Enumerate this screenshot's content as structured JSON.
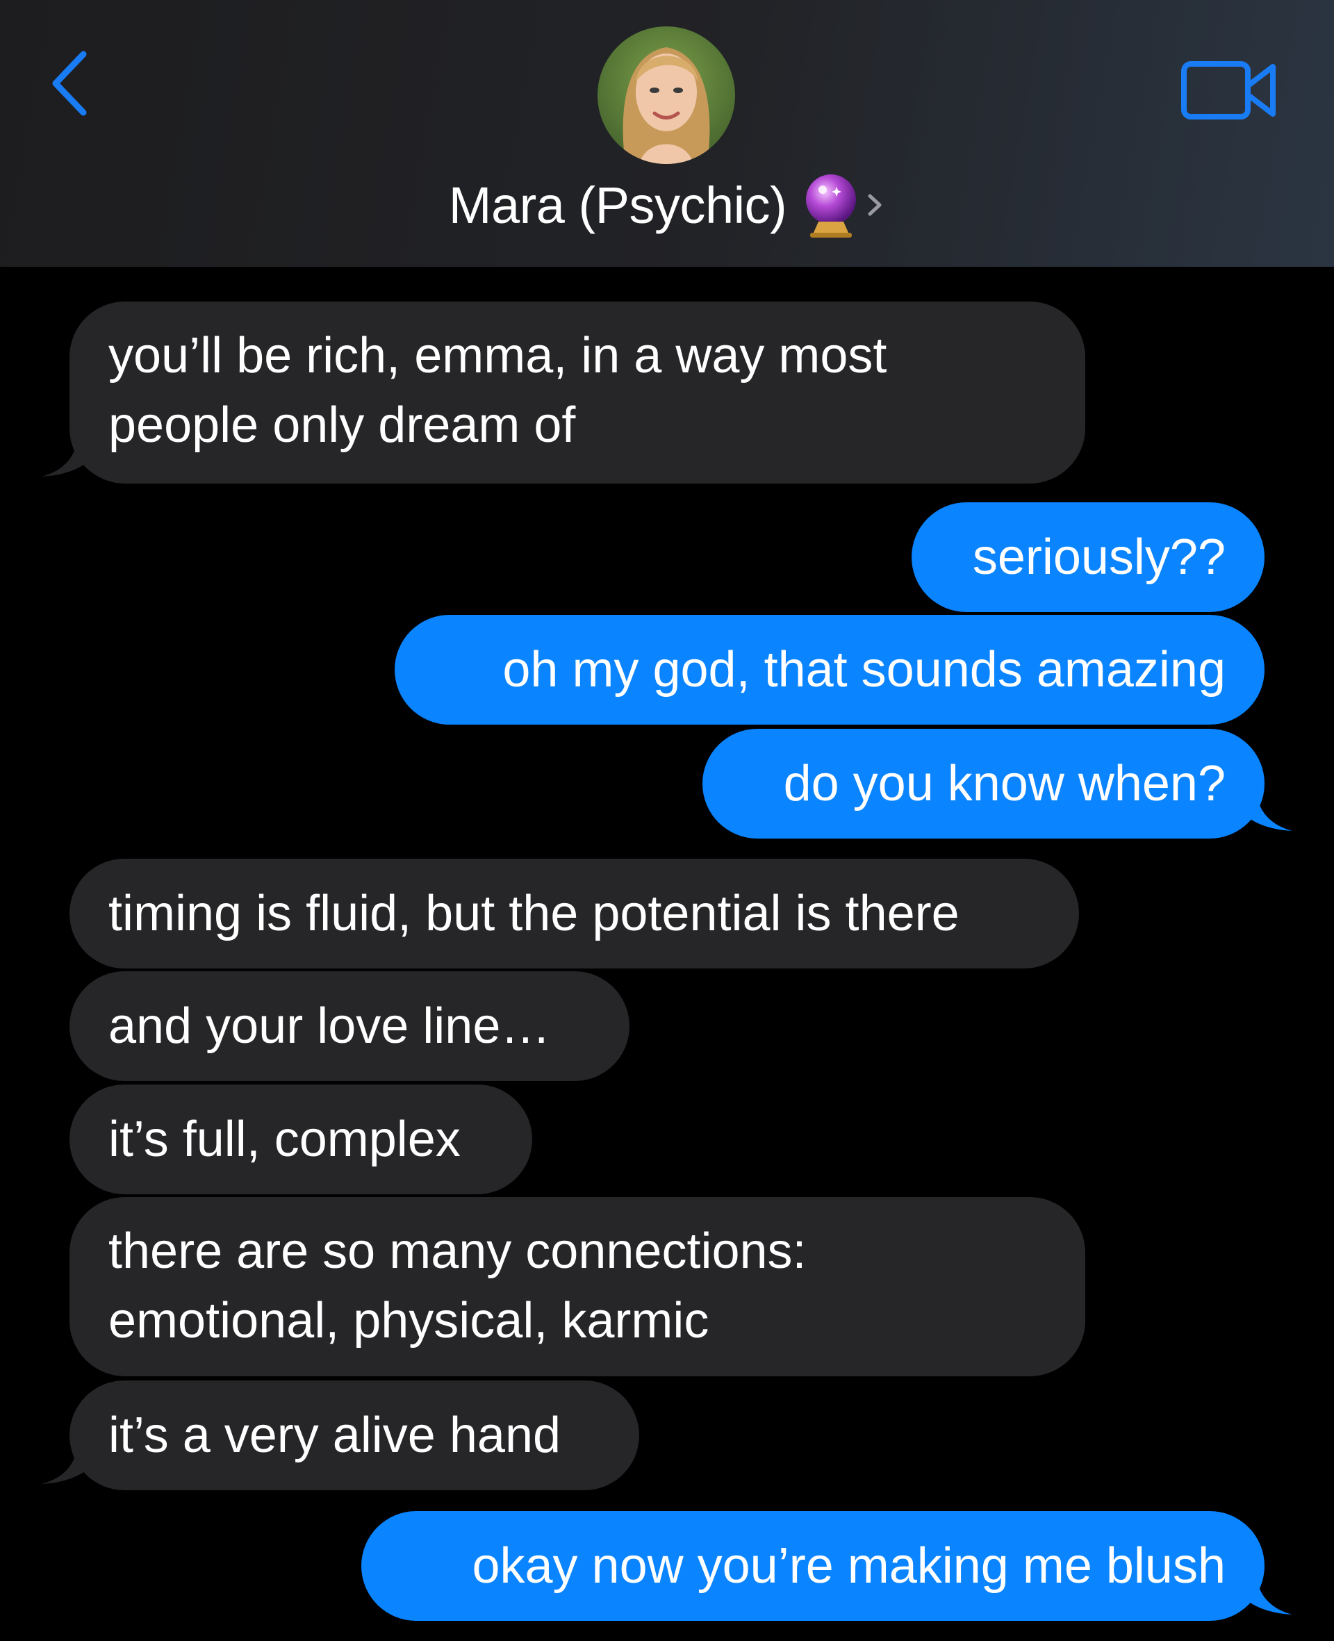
{
  "header": {
    "contact_name": "Mara (Psychic)",
    "back_icon": "chevron-left-icon",
    "video_icon": "video-camera-icon",
    "emoji": "crystal-ball-icon"
  },
  "colors": {
    "sent_bubble": "#0a84ff",
    "received_bubble": "#262628",
    "accent": "#1a7cf5",
    "background": "#000000"
  },
  "messages": [
    {
      "from": "them",
      "text": "you’ll be rich, emma, in a way most people only dream of"
    },
    {
      "from": "me",
      "text": "seriously??"
    },
    {
      "from": "me",
      "text": "oh my god, that sounds amazing"
    },
    {
      "from": "me",
      "text": "do you know when?"
    },
    {
      "from": "them",
      "text": "timing is fluid, but the potential is there"
    },
    {
      "from": "them",
      "text": "and your love line…"
    },
    {
      "from": "them",
      "text": "it’s full, complex"
    },
    {
      "from": "them",
      "text": "there are so many connections: emotional, physical, karmic"
    },
    {
      "from": "them",
      "text": "it’s a very alive hand"
    },
    {
      "from": "me",
      "text": "okay now you’re making me blush"
    }
  ]
}
